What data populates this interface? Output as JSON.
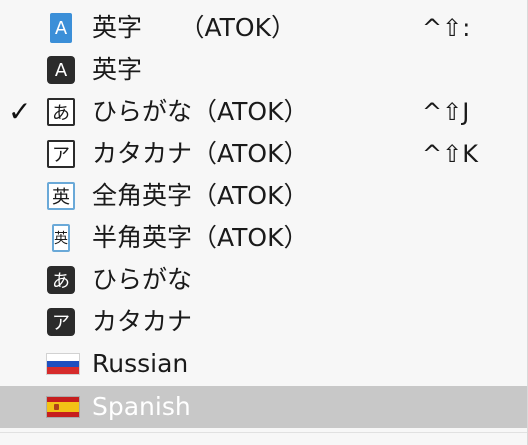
{
  "menu": {
    "items": [
      {
        "label": "英字　　（ATOK）",
        "icon_char": "A",
        "icon": "ATOK-alphanumeric-icon",
        "shortcut": "^⇧:"
      },
      {
        "label": "英字",
        "icon_char": "A",
        "icon": "alphanumeric-icon",
        "shortcut": ""
      },
      {
        "label": "ひらがな（ATOK）",
        "icon_char": "あ",
        "icon": "ATOK-hiragana-icon",
        "shortcut": "^⇧J",
        "checked": true,
        "check": "✓"
      },
      {
        "label": "カタカナ（ATOK）",
        "icon_char": "ア",
        "icon": "ATOK-katakana-icon",
        "shortcut": "^⇧K"
      },
      {
        "label": "全角英字（ATOK）",
        "icon_char": "英",
        "icon": "ATOK-fullwidth-alphanumeric-icon",
        "shortcut": ""
      },
      {
        "label": "半角英字（ATOK）",
        "icon_char": "英",
        "icon": "ATOK-halfwidth-alphanumeric-icon",
        "shortcut": ""
      },
      {
        "label": "ひらがな",
        "icon_char": "あ",
        "icon": "hiragana-icon",
        "shortcut": ""
      },
      {
        "label": "カタカナ",
        "icon_char": "ア",
        "icon": "katakana-icon",
        "shortcut": ""
      },
      {
        "label": "Russian",
        "icon": "russian-flag-icon",
        "shortcut": ""
      },
      {
        "label": "Spanish",
        "icon": "spanish-flag-icon",
        "shortcut": "",
        "selected": true
      }
    ]
  },
  "colors": {
    "highlight": "#c8c8c8",
    "atok_blue": "#3b8fd8",
    "dark_icon": "#2b2b2b"
  }
}
